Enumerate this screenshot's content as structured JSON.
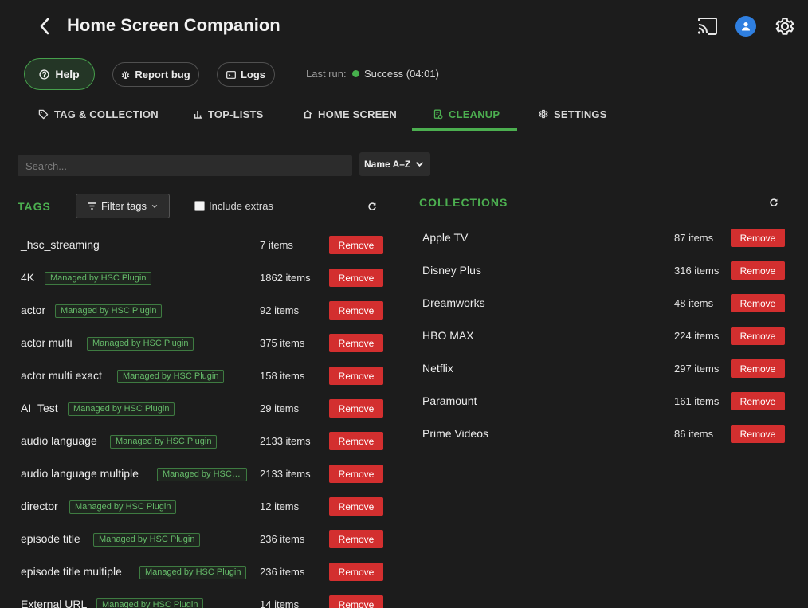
{
  "header": {
    "title": "Home Screen Companion"
  },
  "actions": {
    "help_label": "Help",
    "report_label": "Report bug",
    "logs_label": "Logs",
    "last_run_label": "Last run:",
    "status_text": "Success (04:01)",
    "status_color": "#46b04c"
  },
  "tabs": [
    {
      "label": "TAG & COLLECTION",
      "icon": "tag-icon"
    },
    {
      "label": "TOP-LISTS",
      "icon": "chart-icon"
    },
    {
      "label": "HOME SCREEN",
      "icon": "home-icon"
    },
    {
      "label": "CLEANUP",
      "icon": "cleanup-icon",
      "active": true
    },
    {
      "label": "SETTINGS",
      "icon": "gear-icon"
    }
  ],
  "search": {
    "placeholder": "Search..."
  },
  "sort": {
    "selected": "Name A–Z"
  },
  "tags_section": {
    "title": "TAGS",
    "filter_label": "Filter tags",
    "include_extras_label": "Include extras",
    "remove_label": "Remove",
    "badge_text": "Managed by HSC Plugin",
    "items": [
      {
        "name": "_hsc_streaming",
        "badge": "",
        "count": "7 items"
      },
      {
        "name": "4K",
        "badge": "Managed by HSC Plugin",
        "count": "1862 items"
      },
      {
        "name": "actor",
        "badge": "Managed by HSC Plugin",
        "count": "92 items"
      },
      {
        "name": "actor multi",
        "badge": "Managed by HSC Plugin",
        "count": "375 items"
      },
      {
        "name": "actor multi exact",
        "badge": "Managed by HSC Plugin",
        "count": "158 items"
      },
      {
        "name": "AI_Test",
        "badge": "Managed by HSC Plugin",
        "count": "29 items"
      },
      {
        "name": "audio language",
        "badge": "Managed by HSC Plugin",
        "count": "2133 items"
      },
      {
        "name": "audio language multiple",
        "badge": "Managed by HSC Plugin",
        "count": "2133 items"
      },
      {
        "name": "director",
        "badge": "Managed by HSC Plugin",
        "count": "12 items"
      },
      {
        "name": "episode title",
        "badge": "Managed by HSC Plugin",
        "count": "236 items"
      },
      {
        "name": "episode title multiple",
        "badge": "Managed by HSC Plugin",
        "count": "236 items"
      },
      {
        "name": "External URL",
        "badge": "Managed by HSC Plugin",
        "count": "14 items"
      }
    ]
  },
  "collections_section": {
    "title": "COLLECTIONS",
    "remove_label": "Remove",
    "items": [
      {
        "name": "Apple TV",
        "count": "87 items"
      },
      {
        "name": "Disney Plus",
        "count": "316 items"
      },
      {
        "name": "Dreamworks",
        "count": "48 items"
      },
      {
        "name": "HBO MAX",
        "count": "224 items"
      },
      {
        "name": "Netflix",
        "count": "297 items"
      },
      {
        "name": "Paramount",
        "count": "161 items"
      },
      {
        "name": "Prime Videos",
        "count": "86 items"
      }
    ]
  },
  "colors": {
    "accent": "#4caf50",
    "danger": "#d32f2f",
    "background": "#1c1c1c",
    "avatar": "#2f7fe0"
  }
}
